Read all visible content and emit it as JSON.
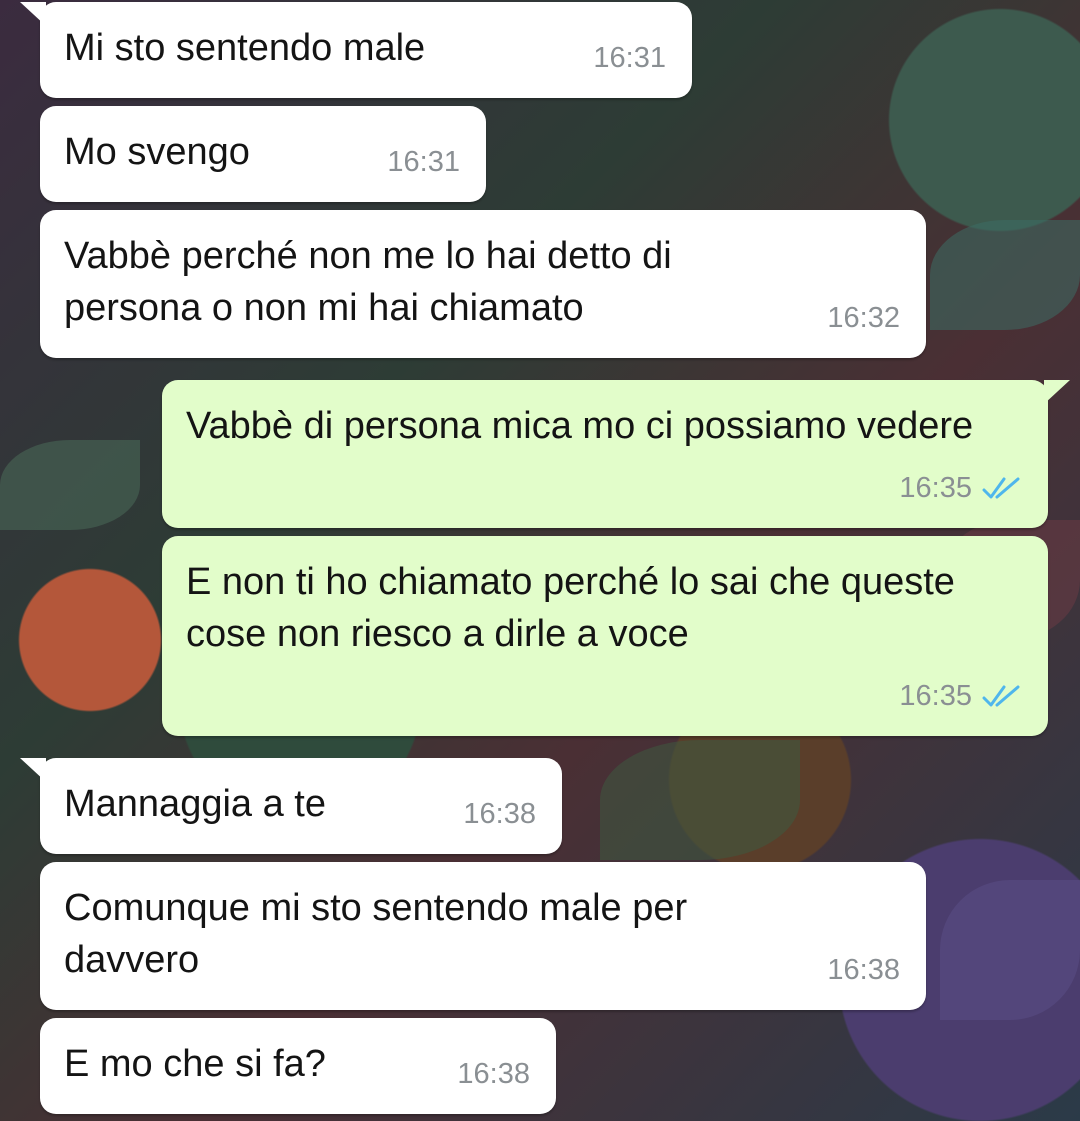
{
  "colors": {
    "incoming_bubble": "#ffffff",
    "outgoing_bubble": "#e2fdca",
    "timestamp": "#8a8f93",
    "read_ticks": "#4fb6ec"
  },
  "messages": [
    {
      "direction": "incoming",
      "text": "Mi sto sentendo male",
      "time": "16:31"
    },
    {
      "direction": "incoming",
      "text": "Mo svengo",
      "time": "16:31"
    },
    {
      "direction": "incoming",
      "text": "Vabbè perché non me lo hai detto di persona o non mi hai chiamato",
      "time": "16:32"
    },
    {
      "direction": "outgoing",
      "text": "Vabbè di persona mica mo ci possiamo vedere",
      "time": "16:35",
      "status": "read-double-check-icon"
    },
    {
      "direction": "outgoing",
      "text": "E non ti ho chiamato perché lo sai che queste cose non riesco a dirle a voce",
      "time": "16:35",
      "status": "read-double-check-icon"
    },
    {
      "direction": "incoming",
      "text": "Mannaggia a te",
      "time": "16:38"
    },
    {
      "direction": "incoming",
      "text": "Comunque mi sto sentendo male per davvero",
      "time": "16:38"
    },
    {
      "direction": "incoming",
      "text": "E mo che si fa?",
      "time": "16:38"
    }
  ]
}
